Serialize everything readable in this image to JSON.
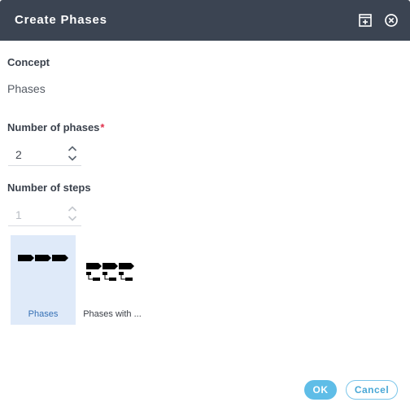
{
  "dialog": {
    "title": "Create Phases",
    "icons": {
      "maximize": "maximize-icon",
      "close": "close-icon"
    }
  },
  "concept": {
    "label": "Concept",
    "value": "Phases"
  },
  "phases": {
    "label": "Number of phases",
    "required_mark": "*",
    "value": "2"
  },
  "steps": {
    "label": "Number of steps",
    "value": "1",
    "disabled": true
  },
  "gallery": {
    "items": [
      {
        "caption": "Phases",
        "selected": true
      },
      {
        "caption": "Phases with ...",
        "selected": false
      }
    ]
  },
  "buttons": {
    "ok": "OK",
    "cancel": "Cancel"
  },
  "colors": {
    "titlebar": "#3b4452",
    "accent": "#5fbde7",
    "required": "#e0304b",
    "selection": "#dfeaf9"
  }
}
